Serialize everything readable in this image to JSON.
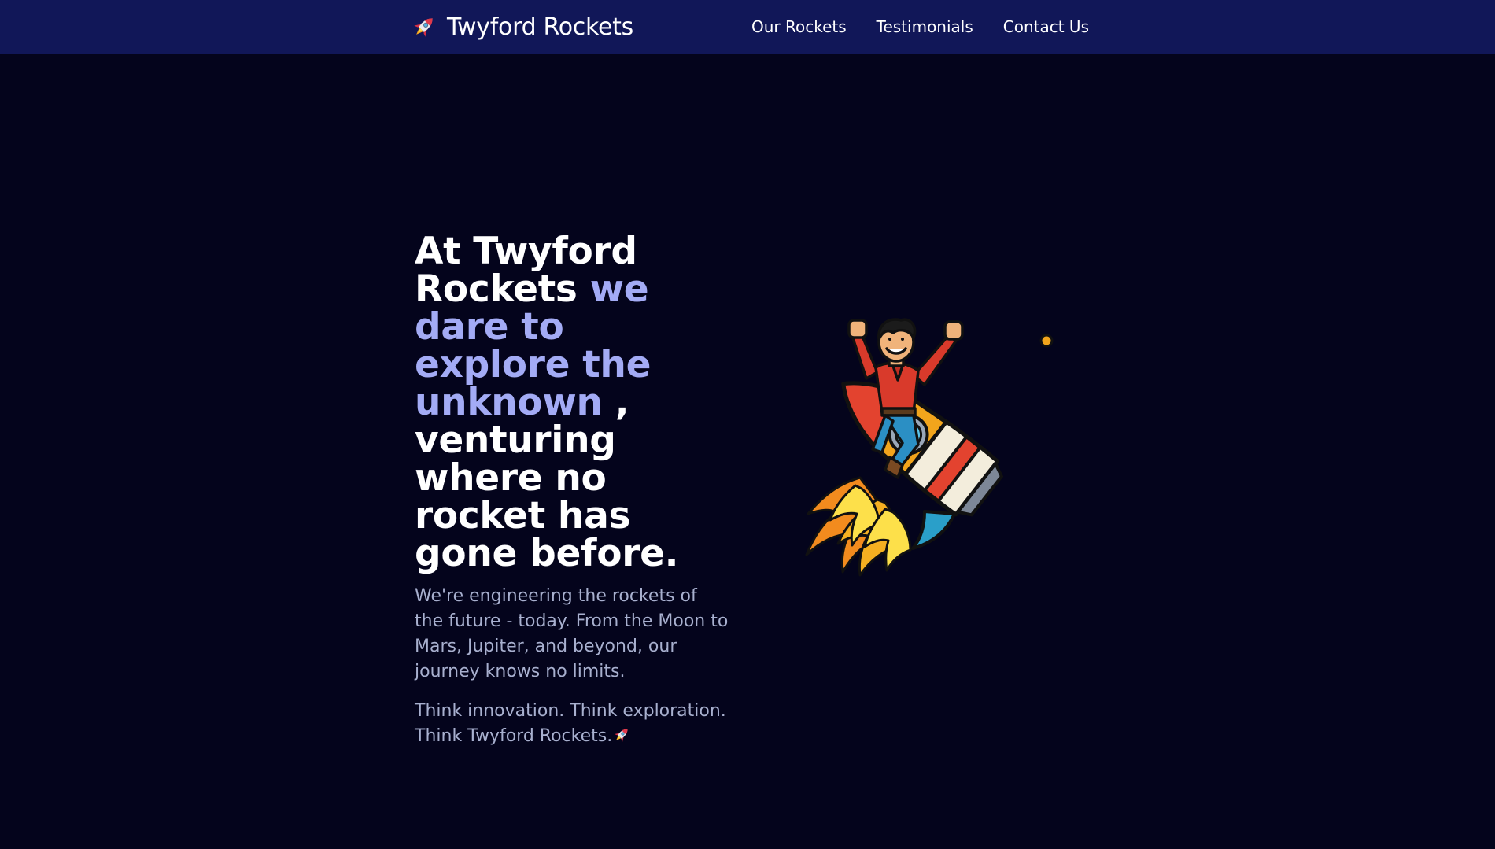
{
  "nav": {
    "brand": "Twyford Rockets",
    "brand_icon": "rocket-icon",
    "links": [
      {
        "label": "Our Rockets"
      },
      {
        "label": "Testimonials"
      },
      {
        "label": "Contact Us"
      }
    ]
  },
  "hero": {
    "headline_part1": "At Twyford Rockets ",
    "headline_accent": "we dare to explore the unknown",
    "headline_part2": " , venturing where no rocket has gone before.",
    "paragraph": "We're engineering the rockets of the future - today. From the Moon to Mars, Jupiter, and beyond, our journey knows no limits.",
    "tagline": "Think innovation. Think exploration. Think Twyford Rockets.",
    "tagline_icon": "rocket-icon",
    "illustration": "man-riding-rocket-illustration"
  },
  "colors": {
    "navbar_bg": "#111758",
    "page_bg": "#04041c",
    "accent": "#a3abf5",
    "body_text": "#a8b0cf"
  }
}
